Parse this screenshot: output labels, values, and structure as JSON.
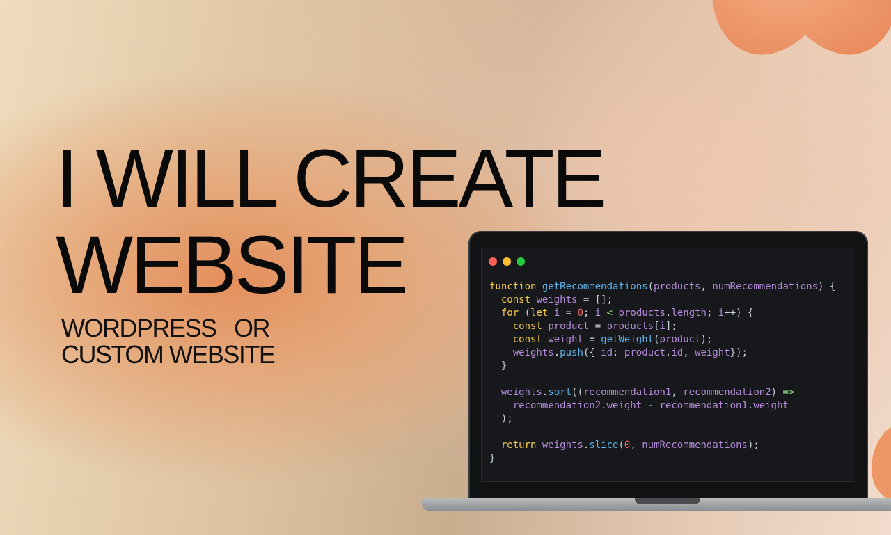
{
  "headline": {
    "line1": "I WILL CREATE",
    "line2": "WEBSITE"
  },
  "subline": {
    "line1": "WORDPRESS   OR",
    "line2": "CUSTOM WEBSITE"
  },
  "colors": {
    "blob": "#ec8f5d",
    "dot_red": "#ff5f57",
    "dot_yellow": "#febc2e",
    "dot_green": "#28c840",
    "code_bg": "#16181c"
  },
  "window_controls": [
    "close-dot",
    "minimize-dot",
    "maximize-dot"
  ],
  "code_lines": [
    "function getRecommendations(products, numRecommendations) {",
    "  const weights = [];",
    "  for (let i = 0; i < products.length; i++) {",
    "    const product = products[i];",
    "    const weight = getWeight(product);",
    "    weights.push({_id: product.id, weight});",
    "  }",
    "",
    "  weights.sort((recommendation1, recommendation2) =>",
    "    recommendation2.weight - recommendation1.weight",
    "  );",
    "",
    "  return weights.slice(0, numRecommendations);",
    "}"
  ]
}
